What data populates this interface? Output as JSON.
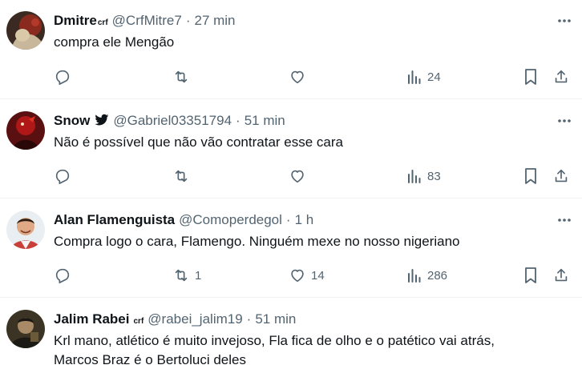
{
  "tweets": [
    {
      "display_name": "Dmitre",
      "name_sup": "crf",
      "handle": "@CrfMitre7",
      "time": "27 min",
      "text": "compra ele Mengão",
      "replies": "",
      "retweets": "",
      "likes": "",
      "views": "24"
    },
    {
      "display_name": "Snow",
      "name_badge_icon": "bird-icon",
      "handle": "@Gabriel03351794",
      "time": "51 min",
      "text": "Não é possível que não vão contratar esse cara",
      "replies": "",
      "retweets": "",
      "likes": "",
      "views": "83"
    },
    {
      "display_name": "Alan Flamenguista",
      "handle": "@Comoperdegol",
      "time": "1 h",
      "text": "Compra logo o cara, Flamengo. Ninguém mexe no nosso nigeriano",
      "replies": "",
      "retweets": "1",
      "likes": "14",
      "views": "286"
    },
    {
      "display_name": "Jalim Rabei",
      "name_sup": "crf",
      "handle": "@rabei_jalim19",
      "time": "51 min",
      "text_lines": [
        "Krl mano, atlético é muito invejoso, Fla fica de olho e o patético vai atrás,",
        "Marcos Braz é o Bertoluci deles"
      ]
    }
  ],
  "colors": {
    "text": "#0f1419",
    "secondary": "#536471",
    "divider": "#eff3f4",
    "accent": "#1d9bf0"
  }
}
